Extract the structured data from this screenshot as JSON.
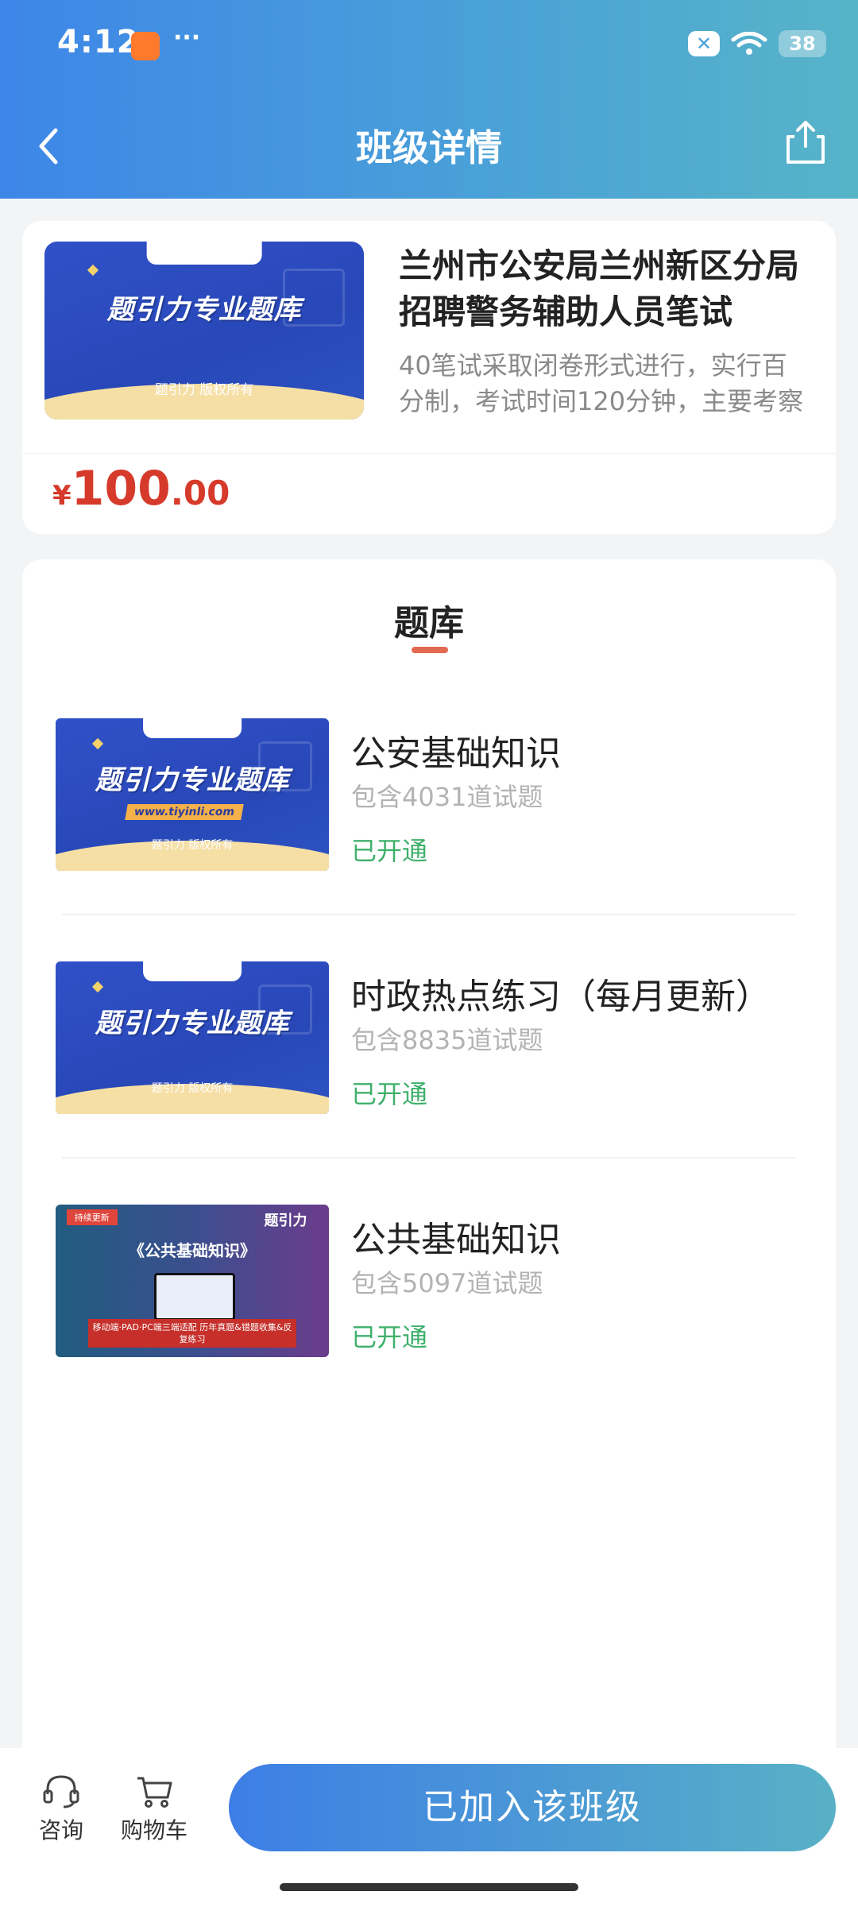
{
  "status_bar": {
    "time": "4:12",
    "dots": "···",
    "battery": "38"
  },
  "nav": {
    "title": "班级详情"
  },
  "course": {
    "title": "兰州市公安局兰州新区分局招聘警务辅助人员笔试",
    "description": "40笔试采取闭卷形式进行，实行百分制，考试时间120分钟，主要考察",
    "thumb_heading": "题引力专业题库",
    "thumb_copyright": "题引力 版权所有",
    "price": {
      "currency": "¥",
      "integer": "100",
      "decimal": ".00"
    }
  },
  "bank_section": {
    "title": "题库"
  },
  "banks": [
    {
      "name": "公安基础知识",
      "count": "包含4031道试题",
      "status": "已开通",
      "thumb": {
        "heading": "题引力专业题库",
        "url": "www.tiyinli.com",
        "copyright": "题引力 版权所有"
      }
    },
    {
      "name": "时政热点练习（每月更新）",
      "count": "包含8835道试题",
      "status": "已开通",
      "thumb": {
        "heading": "题引力专业题库",
        "copyright": "题引力 版权所有"
      }
    },
    {
      "name": "公共基础知识",
      "count": "包含5097道试题",
      "status": "已开通",
      "thumb": {
        "ribbon": "持续更新",
        "logo": "题引力",
        "heading": "《公共基础知识》",
        "footer": "移动端·PAD·PC端三端适配 历年真题&错题收集&反复练习"
      }
    }
  ],
  "bottom_bar": {
    "consult_label": "咨询",
    "cart_label": "购物车",
    "join_button": "已加入该班级"
  },
  "colors": {
    "header_start": "#3d86e8",
    "header_end": "#57b4c8",
    "price": "#d63a2b",
    "status_open": "#3fb06b",
    "tab_underline": "#e36a52"
  }
}
